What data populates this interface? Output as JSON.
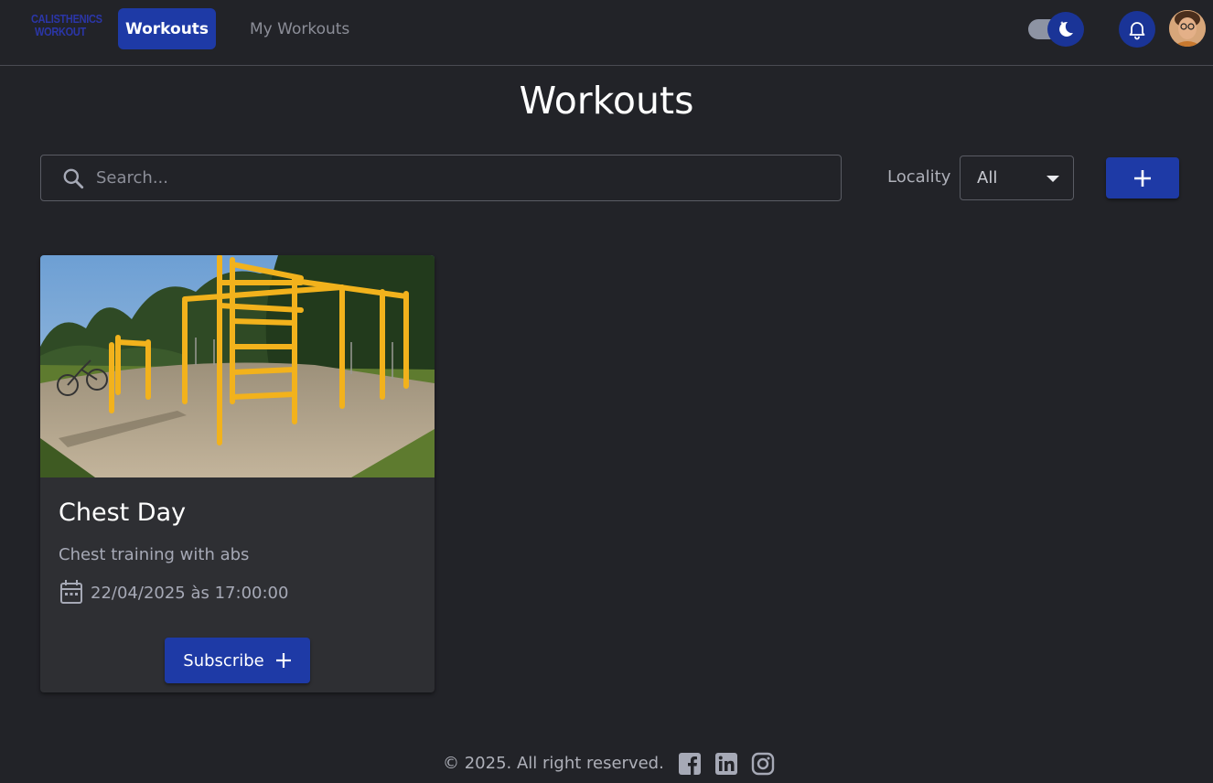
{
  "header": {
    "logo_line1": "CALISTHENICS",
    "logo_line2": "WORKOUT",
    "nav": [
      {
        "label": "Workouts",
        "active": true
      },
      {
        "label": "My Workouts",
        "active": false
      }
    ],
    "theme_toggle": {
      "mode": "dark",
      "icon": "moon-icon"
    },
    "notification_icon": "bell-icon",
    "avatar": "user-avatar"
  },
  "main": {
    "title": "Workouts",
    "search": {
      "placeholder": "Search...",
      "value": ""
    },
    "locality": {
      "label": "Locality",
      "selected": "All"
    },
    "add_icon": "plus-icon"
  },
  "cards": [
    {
      "title": "Chest Day",
      "description": "Chest training with abs",
      "datetime": "22/04/2025 às 17:00:00",
      "button_label": "Subscribe",
      "image": "outdoor calisthenics park"
    }
  ],
  "footer": {
    "copyright": "© 2025. All right reserved.",
    "social": [
      "facebook-icon",
      "linkedin-icon",
      "instagram-icon"
    ]
  },
  "colors": {
    "background": "#222328",
    "card": "#2e2f33",
    "accent": "#1e3aa6",
    "logo": "#2b36a8"
  }
}
